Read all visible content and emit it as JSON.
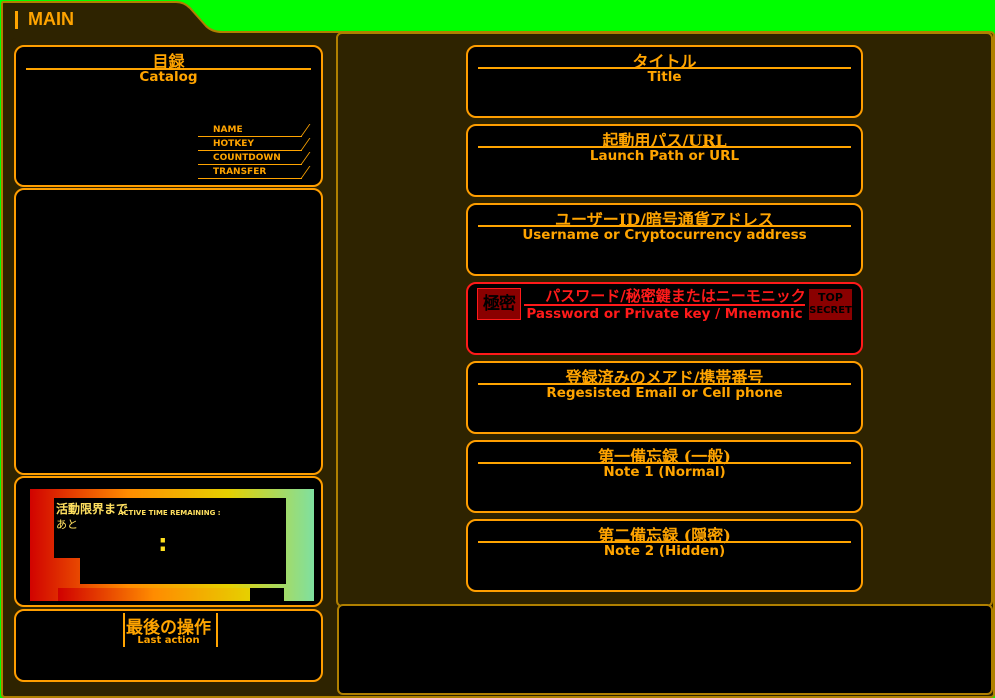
{
  "window": {
    "tab_title": "MAIN"
  },
  "catalog": {
    "title": "目録",
    "subtitle": "Catalog",
    "menu": [
      "NAME",
      "HOTKEY",
      "COUNTDOWN",
      "TRANSFER"
    ]
  },
  "timer": {
    "title_jp_1": "活動限界まで",
    "title_jp_2": "あと",
    "label_en": "ACTIVE TIME REMAINING :",
    "separator": ":"
  },
  "last_action": {
    "title": "最後の操作",
    "subtitle": "Last action"
  },
  "fields": [
    {
      "title": "タイトル",
      "subtitle": "Title"
    },
    {
      "title": "起動用パス/URL",
      "subtitle": "Launch Path or URL"
    },
    {
      "title": "ユーザーID/暗号通貨アドレス",
      "subtitle": "Username or Cryptocurrency address"
    },
    {
      "title": "パスワード/秘密鍵またはニーモニック",
      "subtitle": "Password or Private key / Mnemonic",
      "badge_left": "極密",
      "badge_right_1": "TOP",
      "badge_right_2": "SECRET"
    },
    {
      "title": "登録済みのメアド/携帯番号",
      "subtitle": "Regesisted Email or Cell phone"
    },
    {
      "title": "第一備忘録 (一般)",
      "subtitle": "Note 1 (Normal)"
    },
    {
      "title": "第二備忘録 (隠密)",
      "subtitle": "Note 2 (Hidden)"
    }
  ],
  "colors": {
    "background": "#00ff00",
    "accent": "#ffa400",
    "alert": "#ff1a1a",
    "panel": "#000000"
  }
}
